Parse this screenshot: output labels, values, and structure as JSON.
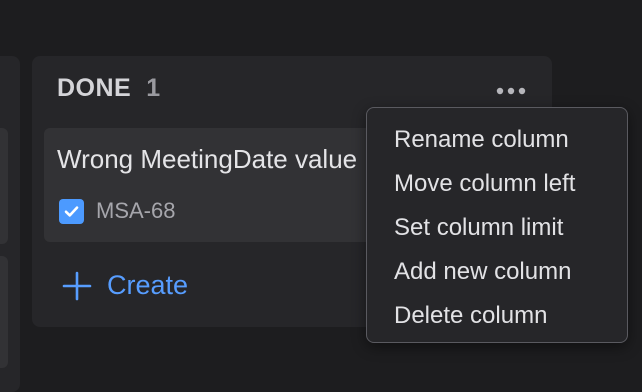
{
  "column": {
    "title": "DONE",
    "count": "1",
    "more_icon": "more-horizontal-icon",
    "card": {
      "title": "Wrong MeetingDate value",
      "issue_key": "MSA-68",
      "type_icon": "checkbox-task-icon"
    },
    "create": {
      "icon": "plus-icon",
      "label": "Create"
    }
  },
  "menu": {
    "items": [
      {
        "label": "Rename column"
      },
      {
        "label": "Move column left"
      },
      {
        "label": "Set column limit"
      },
      {
        "label": "Add new column"
      },
      {
        "label": "Delete column"
      }
    ]
  },
  "colors": {
    "background": "#1d1d1f",
    "column": "#262629",
    "card": "#323235",
    "accent": "#579dff",
    "checkbox": "#4c9aff"
  }
}
